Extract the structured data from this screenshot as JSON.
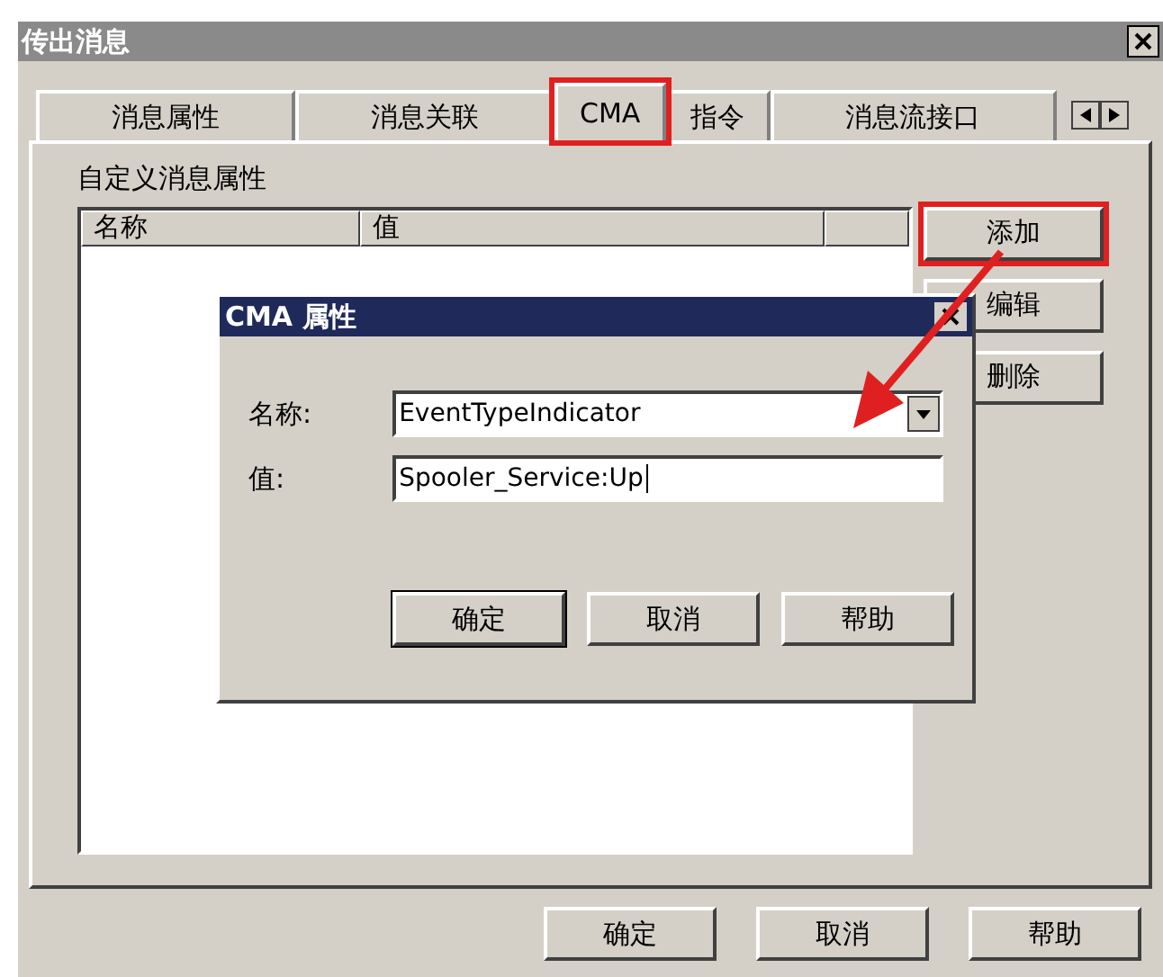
{
  "window": {
    "title": "传出消息"
  },
  "tabs": [
    {
      "label": "消息属性",
      "selected": false,
      "highlighted": false
    },
    {
      "label": "消息关联",
      "selected": false,
      "highlighted": false
    },
    {
      "label": "CMA",
      "selected": true,
      "highlighted": true
    },
    {
      "label": "指令",
      "selected": false,
      "highlighted": false
    },
    {
      "label": "消息流接口",
      "selected": false,
      "highlighted": false
    }
  ],
  "group_label": "自定义消息属性",
  "list": {
    "columns": [
      "名称",
      "值"
    ]
  },
  "side_buttons": [
    {
      "label": "添加",
      "highlighted": true
    },
    {
      "label": "编辑",
      "highlighted": false
    },
    {
      "label": "删除",
      "highlighted": false
    }
  ],
  "dialog": {
    "title": "CMA 属性",
    "fields": [
      {
        "label": "名称:",
        "value": "EventTypeIndicator",
        "kind": "combo"
      },
      {
        "label": "值:",
        "value": "Spooler_Service:Up",
        "kind": "text"
      }
    ],
    "buttons": [
      "确定",
      "取消",
      "帮助"
    ]
  },
  "buttons": [
    "确定",
    "取消",
    "帮助"
  ]
}
